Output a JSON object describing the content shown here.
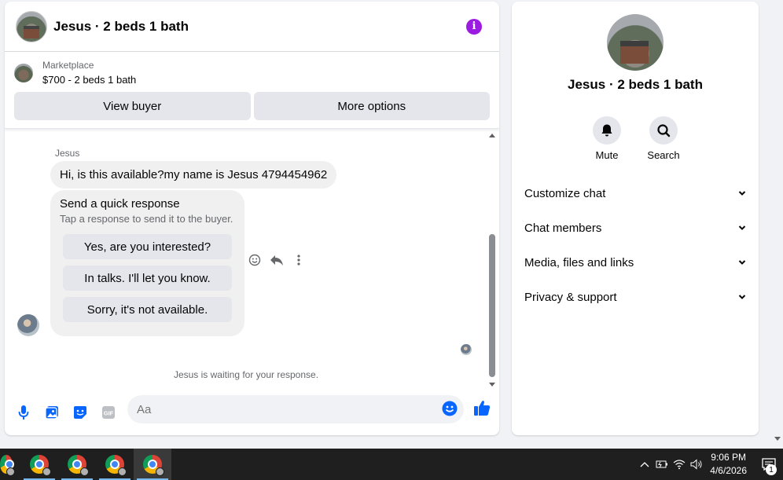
{
  "chat": {
    "title": "Jesus · 2 beds 1 bath",
    "marketplace_label": "Marketplace",
    "listing": "$700 - 2 beds 1 bath",
    "view_buyer": "View buyer",
    "more_options": "More options",
    "sender_name": "Jesus",
    "message": "Hi, is this available?my name is Jesus 4794454962",
    "quick_response_title": "Send a quick response",
    "quick_response_sub": "Tap a response to send it to the buyer.",
    "quick_replies": [
      "Yes, are you interested?",
      "In talks. I'll let you know.",
      "Sorry, it's not available."
    ],
    "waiting": "Jesus is waiting for your response.",
    "composer_placeholder": "Aa"
  },
  "info": {
    "title": "Jesus · 2 beds 1 bath",
    "mute_label": "Mute",
    "search_label": "Search",
    "sections": [
      "Customize chat",
      "Chat members",
      "Media, files and links",
      "Privacy & support"
    ]
  },
  "taskbar": {
    "time": "9:06 PM",
    "date": "4/6/2026",
    "notification_count": "1"
  },
  "colors": {
    "accent": "#0866ff",
    "info": "#9c1be0"
  }
}
